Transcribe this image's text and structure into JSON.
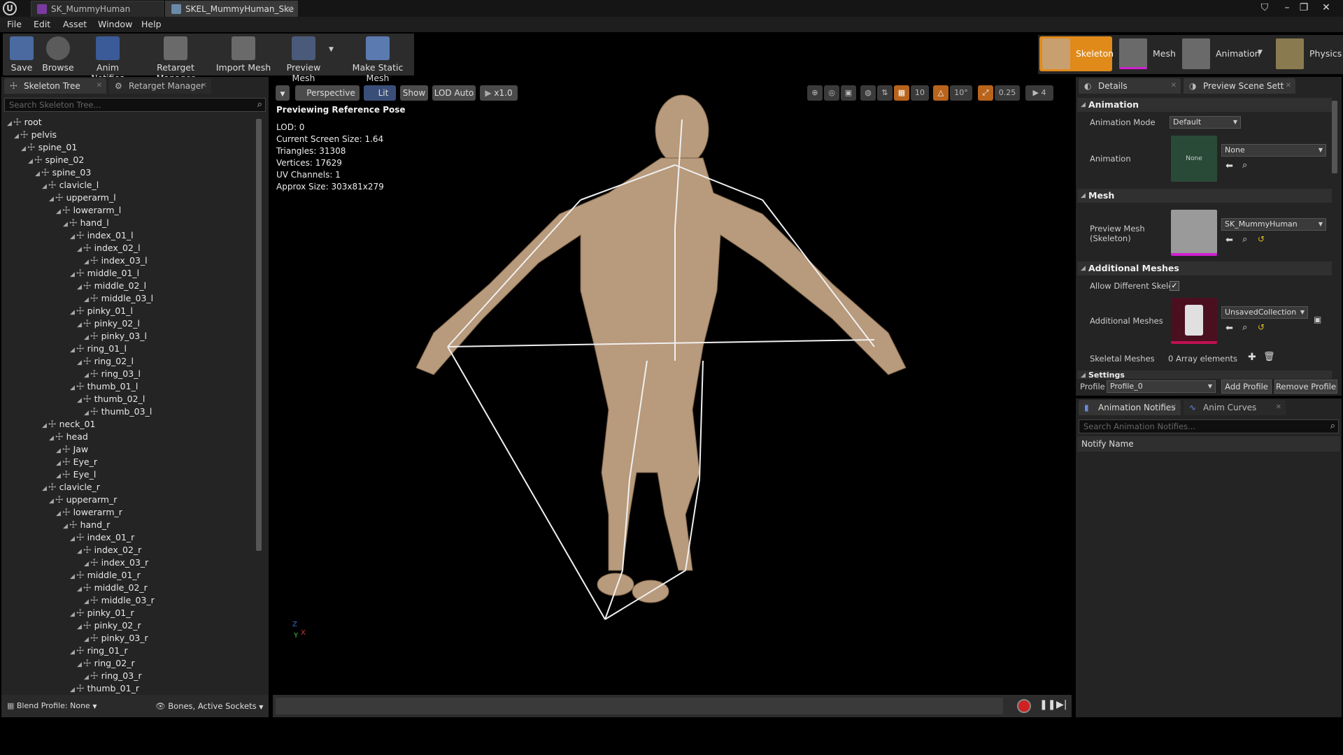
{
  "titlebar": {
    "tabs": [
      {
        "label": "SK_MummyHuman"
      },
      {
        "label": "SKEL_MummyHuman_Ske"
      }
    ],
    "logo": "U"
  },
  "menu": [
    "File",
    "Edit",
    "Asset",
    "Window",
    "Help"
  ],
  "toolbar": {
    "buttons": [
      "Save",
      "Browse",
      "Anim Notifies",
      "Retarget Manager",
      "Import Mesh",
      "Preview Mesh",
      "Make Static Mesh"
    ]
  },
  "modes": [
    "Skeleton",
    "Mesh",
    "Animation",
    "Physics"
  ],
  "left_panel": {
    "tabs": [
      "Skeleton Tree",
      "Retarget Manager"
    ],
    "search_placeholder": "Search Skeleton Tree...",
    "bones": [
      {
        "name": "root",
        "depth": 0
      },
      {
        "name": "pelvis",
        "depth": 1
      },
      {
        "name": "spine_01",
        "depth": 2
      },
      {
        "name": "spine_02",
        "depth": 3
      },
      {
        "name": "spine_03",
        "depth": 4
      },
      {
        "name": "clavicle_l",
        "depth": 5
      },
      {
        "name": "upperarm_l",
        "depth": 6
      },
      {
        "name": "lowerarm_l",
        "depth": 7
      },
      {
        "name": "hand_l",
        "depth": 8
      },
      {
        "name": "index_01_l",
        "depth": 9
      },
      {
        "name": "index_02_l",
        "depth": 10
      },
      {
        "name": "index_03_l",
        "depth": 11
      },
      {
        "name": "middle_01_l",
        "depth": 9
      },
      {
        "name": "middle_02_l",
        "depth": 10
      },
      {
        "name": "middle_03_l",
        "depth": 11
      },
      {
        "name": "pinky_01_l",
        "depth": 9
      },
      {
        "name": "pinky_02_l",
        "depth": 10
      },
      {
        "name": "pinky_03_l",
        "depth": 11
      },
      {
        "name": "ring_01_l",
        "depth": 9
      },
      {
        "name": "ring_02_l",
        "depth": 10
      },
      {
        "name": "ring_03_l",
        "depth": 11
      },
      {
        "name": "thumb_01_l",
        "depth": 9
      },
      {
        "name": "thumb_02_l",
        "depth": 10
      },
      {
        "name": "thumb_03_l",
        "depth": 11
      },
      {
        "name": "neck_01",
        "depth": 5
      },
      {
        "name": "head",
        "depth": 6
      },
      {
        "name": "Jaw",
        "depth": 7
      },
      {
        "name": "Eye_r",
        "depth": 7
      },
      {
        "name": "Eye_l",
        "depth": 7
      },
      {
        "name": "clavicle_r",
        "depth": 5
      },
      {
        "name": "upperarm_r",
        "depth": 6
      },
      {
        "name": "lowerarm_r",
        "depth": 7
      },
      {
        "name": "hand_r",
        "depth": 8
      },
      {
        "name": "index_01_r",
        "depth": 9
      },
      {
        "name": "index_02_r",
        "depth": 10
      },
      {
        "name": "index_03_r",
        "depth": 11
      },
      {
        "name": "middle_01_r",
        "depth": 9
      },
      {
        "name": "middle_02_r",
        "depth": 10
      },
      {
        "name": "middle_03_r",
        "depth": 11
      },
      {
        "name": "pinky_01_r",
        "depth": 9
      },
      {
        "name": "pinky_02_r",
        "depth": 10
      },
      {
        "name": "pinky_03_r",
        "depth": 11
      },
      {
        "name": "ring_01_r",
        "depth": 9
      },
      {
        "name": "ring_02_r",
        "depth": 10
      },
      {
        "name": "ring_03_r",
        "depth": 11
      },
      {
        "name": "thumb_01_r",
        "depth": 9
      }
    ],
    "blend_profile": "Blend Profile: None",
    "visibility": "Bones, Active Sockets"
  },
  "viewport": {
    "perspective": "Perspective",
    "lit": "Lit",
    "show": "Show",
    "lod": "LOD Auto",
    "speed": "x1.0",
    "grid_snap": "10",
    "rot_snap": "10°",
    "scale_snap": "0.25",
    "cam_speed": "4",
    "preview_title": "Previewing Reference Pose",
    "stats": [
      "LOD: 0",
      "Current Screen Size: 1.64",
      "Triangles: 31308",
      "Vertices: 17629",
      "UV Channels: 1",
      "Approx Size: 303x81x279"
    ]
  },
  "details": {
    "tabs": [
      "Details",
      "Preview Scene Sett"
    ],
    "animation_section": "Animation",
    "animation_mode_label": "Animation Mode",
    "animation_mode_value": "Default",
    "animation_label": "Animation",
    "animation_thumb_text": "None",
    "animation_value": "None",
    "mesh_section": "Mesh",
    "preview_mesh_label": "Preview Mesh (Skeleton)",
    "preview_mesh_value": "SK_MummyHuman",
    "additional_section": "Additional Meshes",
    "allow_diff_label": "Allow Different Skelet",
    "additional_label": "Additional Meshes",
    "additional_value": "UnsavedCollection",
    "skeletal_label": "Skeletal Meshes",
    "skeletal_value": "0 Array elements",
    "settings_section": "Settings",
    "profile_label": "Profile",
    "profile_value": "Profile_0",
    "add_profile": "Add Profile",
    "remove_profile": "Remove Profile"
  },
  "notifies": {
    "tabs": [
      "Animation Notifies",
      "Anim Curves"
    ],
    "search_placeholder": "Search Animation Notifies...",
    "column": "Notify Name"
  }
}
